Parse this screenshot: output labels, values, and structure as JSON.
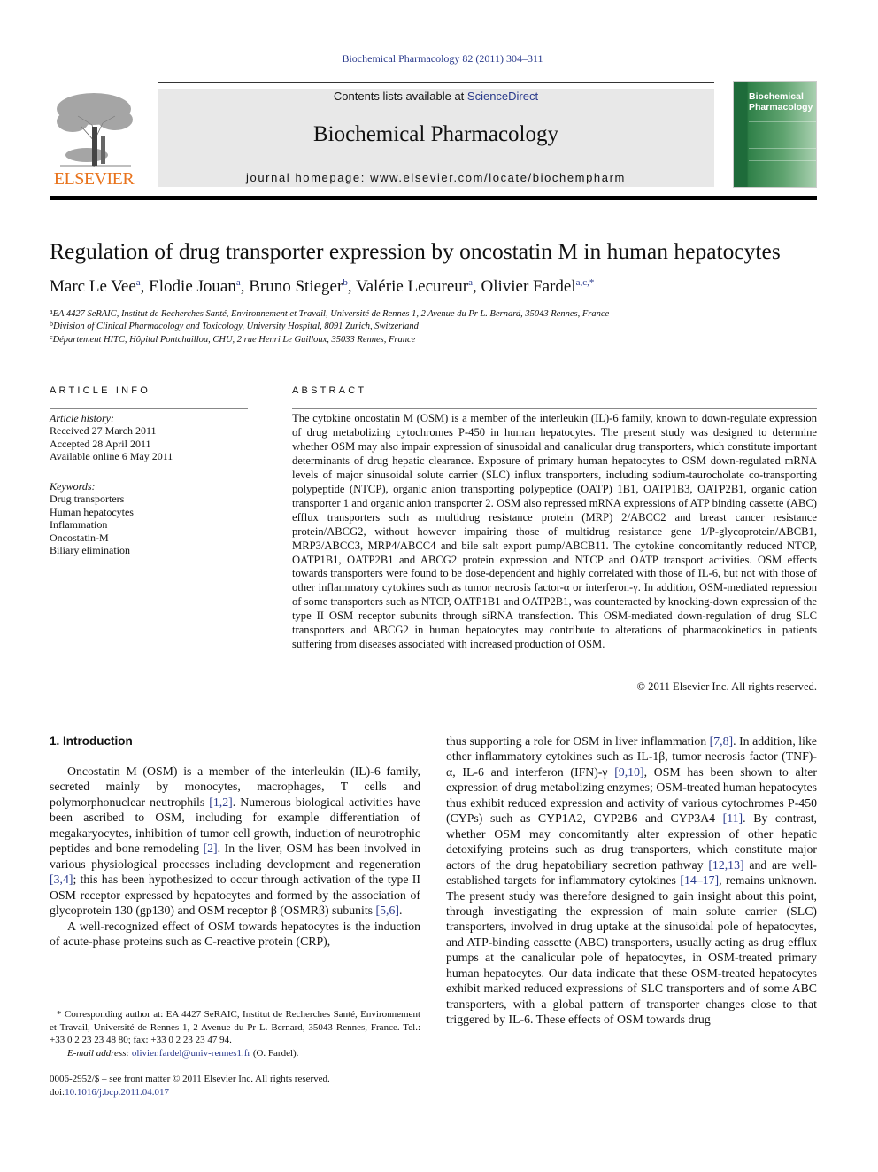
{
  "header": {
    "journal_ref": "Biochemical Pharmacology 82 (2011) 304–311",
    "contents_prefix": "Contents lists available at ",
    "contents_link": "ScienceDirect",
    "journal_title": "Biochemical Pharmacology",
    "homepage": "journal homepage: www.elsevier.com/locate/biochempharm",
    "publisher_logo_text": "ELSEVIER",
    "cover_title_line1": "Biochemical",
    "cover_title_line2": "Pharmacology",
    "colors": {
      "publisher_orange": "#e8731c",
      "link_blue": "#2a3a8c",
      "cover_green": "#1e6b3a"
    }
  },
  "article": {
    "title": "Regulation of drug transporter expression by oncostatin M in human hepatocytes",
    "authors": [
      {
        "name": "Marc Le Vee",
        "sup": "a",
        "sep": ", "
      },
      {
        "name": "Elodie Jouan",
        "sup": "a",
        "sep": ", "
      },
      {
        "name": "Bruno Stieger",
        "sup": "b",
        "sep": ", "
      },
      {
        "name": "Valérie Lecureur",
        "sup": "a",
        "sep": ", "
      },
      {
        "name": "Olivier Fardel",
        "sup": "a,c,*",
        "sep": ""
      }
    ],
    "affiliations": [
      {
        "key": "a",
        "text": "EA 4427 SeRAIC, Institut de Recherches Santé, Environnement et Travail, Université de Rennes 1, 2 Avenue du Pr L. Bernard, 35043 Rennes, France"
      },
      {
        "key": "b",
        "text": "Division of Clinical Pharmacology and Toxicology, University Hospital, 8091 Zurich, Switzerland"
      },
      {
        "key": "c",
        "text": "Département HITC, Hôpital Pontchaillou, CHU, 2 rue Henri Le Guilloux, 35033 Rennes, France"
      }
    ]
  },
  "article_info": {
    "heading": "ARTICLE INFO",
    "history_label": "Article history:",
    "history": [
      "Received 27 March 2011",
      "Accepted 28 April 2011",
      "Available online 6 May 2011"
    ],
    "keywords_label": "Keywords:",
    "keywords": [
      "Drug transporters",
      "Human hepatocytes",
      "Inflammation",
      "Oncostatin-M",
      "Biliary elimination"
    ]
  },
  "abstract": {
    "heading": "ABSTRACT",
    "text": "The cytokine oncostatin M (OSM) is a member of the interleukin (IL)-6 family, known to down-regulate expression of drug metabolizing cytochromes P-450 in human hepatocytes. The present study was designed to determine whether OSM may also impair expression of sinusoidal and canalicular drug transporters, which constitute important determinants of drug hepatic clearance. Exposure of primary human hepatocytes to OSM down-regulated mRNA levels of major sinusoidal solute carrier (SLC) influx transporters, including sodium-taurocholate co-transporting polypeptide (NTCP), organic anion transporting polypeptide (OATP) 1B1, OATP1B3, OATP2B1, organic cation transporter 1 and organic anion transporter 2. OSM also repressed mRNA expressions of ATP binding cassette (ABC) efflux transporters such as multidrug resistance protein (MRP) 2/ABCC2 and breast cancer resistance protein/ABCG2, without however impairing those of multidrug resistance gene 1/P-glycoprotein/ABCB1, MRP3/ABCC3, MRP4/ABCC4 and bile salt export pump/ABCB11. The cytokine concomitantly reduced NTCP, OATP1B1, OATP2B1 and ABCG2 protein expression and NTCP and OATP transport activities. OSM effects towards transporters were found to be dose-dependent and highly correlated with those of IL-6, but not with those of other inflammatory cytokines such as tumor necrosis factor-α or interferon-γ. In addition, OSM-mediated repression of some transporters such as NTCP, OATP1B1 and OATP2B1, was counteracted by knocking-down expression of the type II OSM receptor subunits through siRNA transfection. This OSM-mediated down-regulation of drug SLC transporters and ABCG2 in human hepatocytes may contribute to alterations of pharmacokinetics in patients suffering from diseases associated with increased production of OSM.",
    "copyright": "© 2011 Elsevier Inc. All rights reserved."
  },
  "body": {
    "section_heading": "1.  Introduction",
    "left_col": [
      {
        "indent": true,
        "segments": [
          {
            "t": "Oncostatin M (OSM) is a member of the interleukin (IL)-6 family, secreted mainly by monocytes, macrophages, T cells and polymorphonuclear neutrophils "
          },
          {
            "r": "[1,2]"
          },
          {
            "t": ". Numerous biological activities have been ascribed to OSM, including for example differentiation of megakaryocytes, inhibition of tumor cell growth, induction of neurotrophic peptides and bone remodeling "
          },
          {
            "r": "[2]"
          },
          {
            "t": ". In the liver, OSM has been involved in various physiological processes including development and regeneration "
          },
          {
            "r": "[3,4]"
          },
          {
            "t": "; this has been hypothesized to occur through activation of the type II OSM receptor expressed by hepatocytes and formed by the association of glycoprotein 130 (gp130) and OSM receptor β (OSMRβ) subunits "
          },
          {
            "r": "[5,6]"
          },
          {
            "t": "."
          }
        ]
      },
      {
        "indent": true,
        "segments": [
          {
            "t": "A well-recognized effect of OSM towards hepatocytes is the induction of acute-phase proteins such as C-reactive protein (CRP),"
          }
        ]
      }
    ],
    "right_col": [
      {
        "indent": false,
        "segments": [
          {
            "t": "thus supporting a role for OSM in liver inflammation "
          },
          {
            "r": "[7,8]"
          },
          {
            "t": ". In addition, like other inflammatory cytokines such as IL-1β, tumor necrosis factor (TNF)-α, IL-6 and interferon (IFN)-γ "
          },
          {
            "r": "[9,10]"
          },
          {
            "t": ", OSM has been shown to alter expression of drug metabolizing enzymes; OSM-treated human hepatocytes thus exhibit reduced expression and activity of various cytochromes P-450 (CYPs) such as CYP1A2, CYP2B6 and CYP3A4 "
          },
          {
            "r": "[11]"
          },
          {
            "t": ". By contrast, whether OSM may concomitantly alter expression of other hepatic detoxifying proteins such as drug transporters, which constitute major actors of the drug hepatobiliary secretion pathway "
          },
          {
            "r": "[12,13]"
          },
          {
            "t": " and are well-established targets for inflammatory cytokines "
          },
          {
            "r": "[14–17]"
          },
          {
            "t": ", remains unknown. The present study was therefore designed to gain insight about this point, through investigating the expression of main solute carrier (SLC) transporters, involved in drug uptake at the sinusoidal pole of hepatocytes, and ATP-binding cassette (ABC) transporters, usually acting as drug efflux pumps at the canalicular pole of hepatocytes, in OSM-treated primary human hepatocytes. Our data indicate that these OSM-treated hepatocytes exhibit marked reduced expressions of SLC transporters and of some ABC transporters, with a global pattern of transporter changes close to that triggered by IL-6. These effects of OSM towards drug"
          }
        ]
      }
    ]
  },
  "footnote": {
    "corresponding": "* Corresponding author at: EA 4427 SeRAIC, Institut de Recherches Santé, Environnement et Travail, Université de Rennes 1, 2 Avenue du Pr L. Bernard, 35043 Rennes, France. Tel.: +33 0 2 23 23 48 80; fax: +33 0 2 23 23 47 94.",
    "email_label": "E-mail address:",
    "email": "olivier.fardel@univ-rennes1.fr",
    "email_suffix": " (O. Fardel)."
  },
  "front_matter": {
    "issn_line": "0006-2952/$ – see front matter © 2011 Elsevier Inc. All rights reserved.",
    "doi_label": "doi:",
    "doi": "10.1016/j.bcp.2011.04.017"
  }
}
